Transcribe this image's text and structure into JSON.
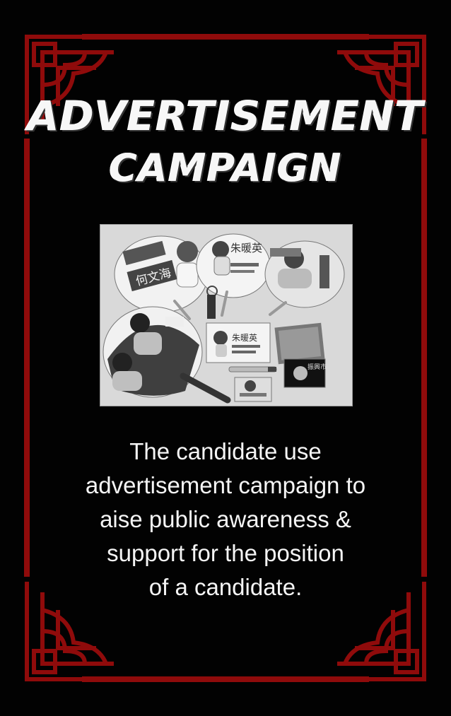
{
  "title": {
    "line1": "ADVERTISEMENT",
    "line2": "CAMPAIGN"
  },
  "caption": {
    "line1": "The candidate use",
    "line2": "advertisement campaign to",
    "line3": "aise public awareness &",
    "line4": "support for the position",
    "line5": "of a candidate."
  },
  "photo": {
    "fan1_name": "何文海",
    "fan2_name": "朱暖英",
    "card_name": "朱暖英",
    "badge_text": "振興市"
  },
  "colors": {
    "background": "#020202",
    "frame_red": "#8f0b0b",
    "title_text": "#f7f7f7",
    "caption_text": "#f5f5f5"
  }
}
